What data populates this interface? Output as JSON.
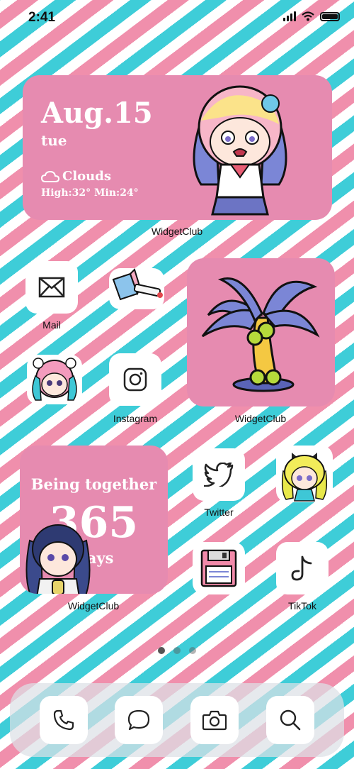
{
  "status_bar": {
    "time": "2:41"
  },
  "weather_widget": {
    "date": "Aug.15",
    "weekday": "tue",
    "condition": "Clouds",
    "high_low": "High:32° Min:24°",
    "label": "WidgetClub"
  },
  "apps": {
    "mail": "Mail",
    "instagram": "Instagram",
    "twitter": "Twitter",
    "tiktok": "TikTok"
  },
  "palm_widget": {
    "label": "WidgetClub"
  },
  "counter_widget": {
    "line1": "Being together",
    "count": "365",
    "unit": "Days",
    "label": "WidgetClub"
  },
  "page_indicator": {
    "pages": 3,
    "active": 1
  },
  "dock": [
    "phone",
    "messages",
    "camera",
    "search"
  ],
  "colors": {
    "pink": "#e68bb0",
    "cyan": "#3ecdd8",
    "stripe_pink": "#f08fac"
  }
}
